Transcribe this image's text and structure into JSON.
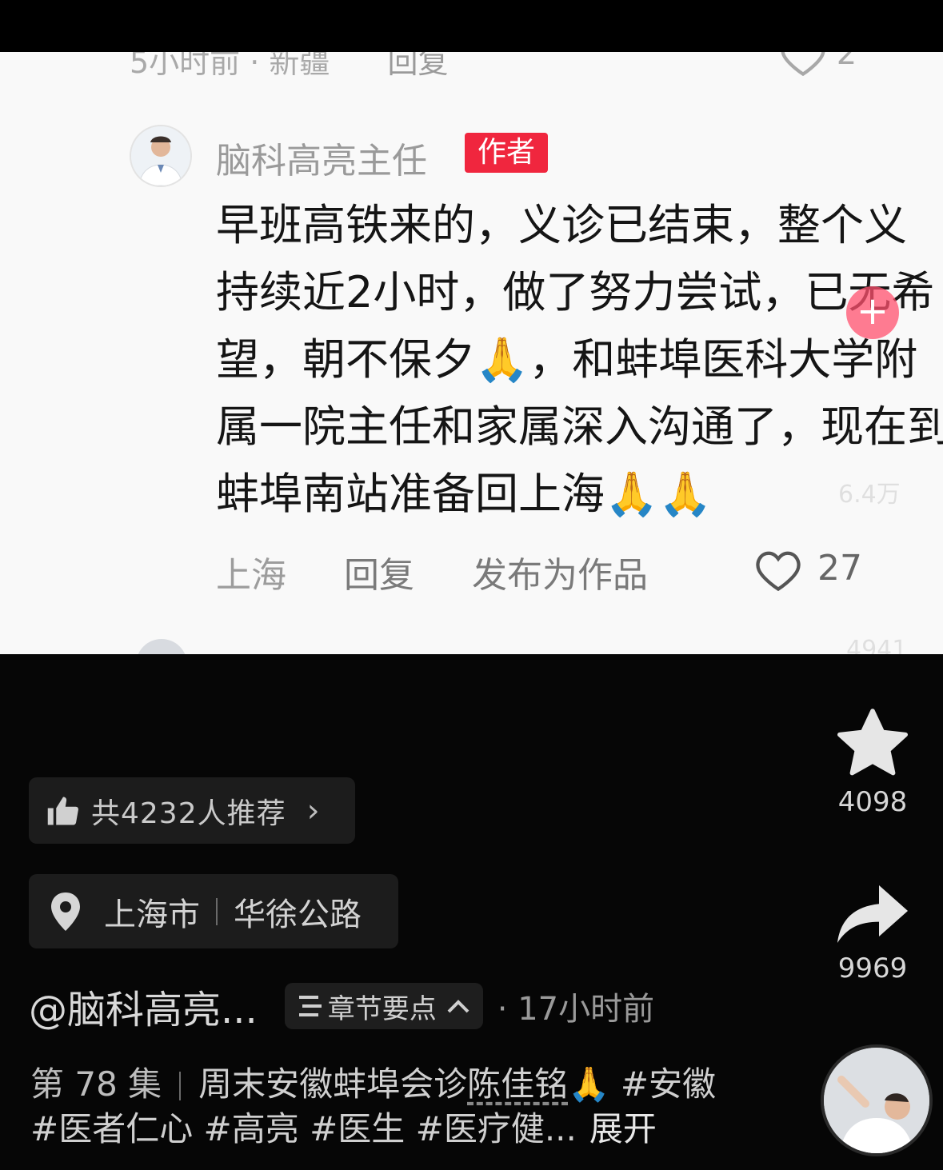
{
  "comment_screenshot": {
    "prev_meta": "5小时前 · 新疆",
    "prev_reply": "回复",
    "prev_like_count": "2",
    "author_name": "脑科高亮主任",
    "author_badge": "作者",
    "lines": [
      "早班高铁来的，义诊已结束，整个义",
      "持续近2小时，做了努力尝试，已无希",
      "望，朝不保夕",
      "，和蚌埠医科大学附",
      "属一院主任和家属深入沟通了，现在到",
      "蚌埠南站准备回上海"
    ],
    "pray_emoji": "🙏",
    "location": "上海",
    "reply": "回复",
    "publish": "发布为作品",
    "like_count": "27"
  },
  "overlay": {
    "plus": "+",
    "count_a": "6.4万",
    "count_b": "4941"
  },
  "sidebar": {
    "favorite_count": "4098",
    "share_count": "9969"
  },
  "recommend": {
    "label": "共4232人推荐",
    "chevron": "›"
  },
  "location_tag": {
    "city": "上海市",
    "road": "华徐公路"
  },
  "author_row": {
    "handle": "@脑科高亮...",
    "chapter_label": "章节要点",
    "time": "· 17小时前"
  },
  "caption": {
    "episode": "第 78 集",
    "text_a": "周末安徽蚌埠会诊",
    "name": "陈佳铭",
    "emoji": "🙏",
    "text_b": "#安徽 #医者仁心 #高亮 #医生 #医疗健...",
    "expand": "展开"
  },
  "colors": {
    "badge_red": "#f0263e",
    "panel_bg": "#f9f9f9",
    "page_bg": "#060606"
  }
}
